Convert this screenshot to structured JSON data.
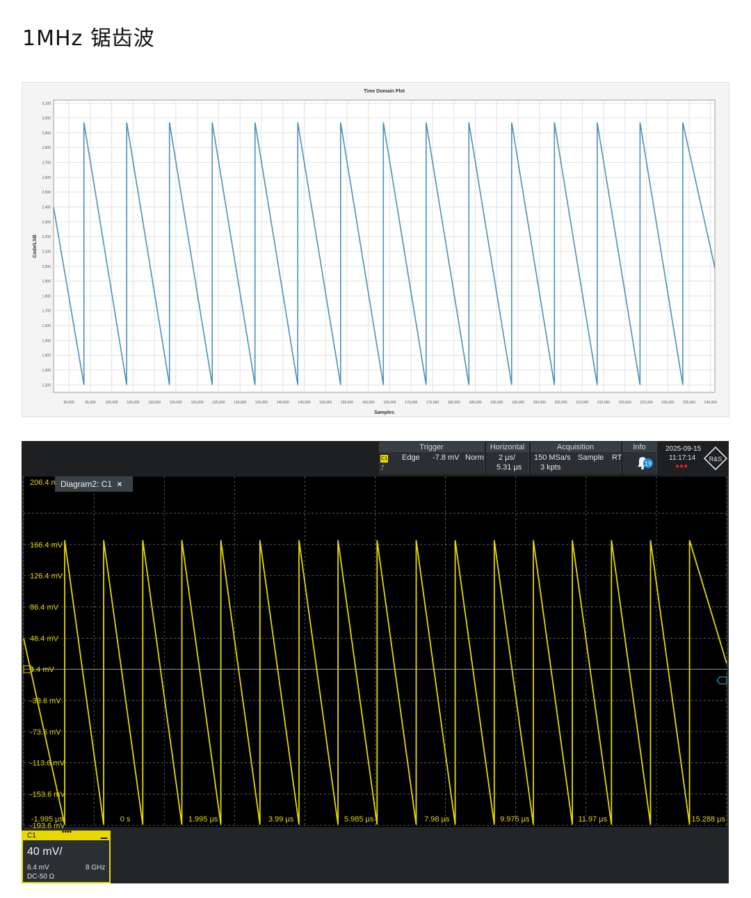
{
  "page_title": "1MHz 锯齿波",
  "chart_data": [
    {
      "type": "line",
      "title": "Time Domain Plot",
      "xlabel": "Samples",
      "ylabel": "Code/LSB",
      "xlim": [
        86400,
        241000
      ],
      "ylim": [
        1150,
        3120
      ],
      "x_ticks": [
        90000,
        95000,
        100000,
        105000,
        110000,
        115000,
        120000,
        125000,
        130000,
        135000,
        140000,
        145000,
        150000,
        155000,
        160000,
        165000,
        170000,
        175000,
        180000,
        185000,
        190000,
        195000,
        200000,
        205000,
        210000,
        215000,
        220000,
        225000,
        230000,
        235000,
        240000
      ],
      "x_tick_labels": [
        "90,000",
        "95,000",
        "100,000",
        "105,000",
        "110,000",
        "115,000",
        "120,000",
        "125,000",
        "130,000",
        "135,000",
        "140,000",
        "145,000",
        "150,000",
        "155,000",
        "160,000",
        "165,000",
        "170,000",
        "175,000",
        "180,000",
        "185,000",
        "190,000",
        "195,000",
        "200,000",
        "205,000",
        "210,000",
        "215,000",
        "220,000",
        "225,000",
        "230,000",
        "235,000",
        "240,000"
      ],
      "y_ticks": [
        1200,
        1300,
        1400,
        1500,
        1600,
        1700,
        1800,
        1900,
        2000,
        2100,
        2200,
        2300,
        2400,
        2500,
        2600,
        2700,
        2800,
        2900,
        3000,
        3100
      ],
      "y_tick_labels": [
        "1,200",
        "1,300",
        "1,400",
        "1,500",
        "1,600",
        "1,700",
        "1,800",
        "1,900",
        "2,000",
        "2,100",
        "2,200",
        "2,300",
        "2,400",
        "2,500",
        "2,600",
        "2,700",
        "2,800",
        "2,900",
        "3,000",
        "3,100"
      ],
      "grid": true,
      "series": [
        {
          "color": "#4a8fb8",
          "x": [
            86400,
            93500,
            93500,
            103500,
            103500,
            113500,
            113500,
            123500,
            123500,
            133500,
            133500,
            143500,
            143500,
            153500,
            153500,
            163500,
            163500,
            173500,
            173500,
            183500,
            183500,
            193500,
            193500,
            203500,
            203500,
            213500,
            213500,
            223500,
            223500,
            233500,
            233500,
            241000
          ],
          "y": [
            2400,
            1200,
            2970,
            1200,
            2970,
            1200,
            2970,
            1200,
            2970,
            1200,
            2970,
            1200,
            2970,
            1200,
            2970,
            1200,
            2970,
            1200,
            2970,
            1200,
            2970,
            1200,
            2970,
            1200,
            2970,
            1200,
            2970,
            1200,
            2970,
            1200,
            2970,
            1990
          ]
        }
      ]
    },
    {
      "type": "line",
      "xlim": [
        -2.6,
        15.4
      ],
      "ylim": [
        -196,
        210
      ],
      "x_ticks": [
        -1.995,
        0,
        1.995,
        3.99,
        5.985,
        7.98,
        9.975,
        11.97,
        15.288
      ],
      "x_tick_labels": [
        "-1.995 µs",
        "0 s",
        "1.995 µs",
        "3.99 µs",
        "5.985 µs",
        "7.98 µs",
        "9.975 µs",
        "11.97 µs",
        "15.288 µs"
      ],
      "y_ticks": [
        206.4,
        166.4,
        126.4,
        86.4,
        46.4,
        6.4,
        -33.6,
        -73.6,
        -113.6,
        -153.6,
        -193.6
      ],
      "y_tick_labels": [
        "206.4 mV",
        "166.4 mV",
        "126.4 mV",
        "86.4 mV",
        "46.4 mV",
        "6.4 mV",
        "-33.6 mV",
        "-73.6 mV",
        "-113.6 mV",
        "-153.6 mV",
        "-193.6 mV"
      ],
      "grid": true,
      "series": [
        {
          "name": "C1",
          "color": "#e8d800",
          "x": [
            -2.6,
            -1.55,
            -1.55,
            -0.55,
            -0.55,
            0.45,
            0.45,
            1.45,
            1.45,
            2.45,
            2.45,
            3.45,
            3.45,
            4.45,
            4.45,
            5.45,
            5.45,
            6.45,
            6.45,
            7.45,
            7.45,
            8.45,
            8.45,
            9.45,
            9.45,
            10.45,
            10.45,
            11.45,
            11.45,
            12.45,
            12.45,
            13.45,
            13.45,
            14.45,
            14.45,
            15.4
          ],
          "y": [
            46,
            -193,
            172,
            -193,
            172,
            -193,
            172,
            -193,
            172,
            -193,
            172,
            -193,
            172,
            -193,
            172,
            -193,
            172,
            -193,
            172,
            -193,
            172,
            -193,
            172,
            -193,
            172,
            -193,
            172,
            -193,
            172,
            -193,
            172,
            -193,
            172,
            -193,
            172,
            14
          ]
        }
      ]
    }
  ],
  "scope": {
    "diagram_tab_label": "Diagram2: C1",
    "diagram_tab_close": "×",
    "header": {
      "trigger_title": "Trigger",
      "trigger_channel": "C1",
      "trigger_type": "Edge",
      "trigger_level": "-7.8 mV",
      "trigger_mode": "Norm",
      "horizontal_title": "Horizontal",
      "horizontal_scale": "2 µs/",
      "horizontal_position": "5.31 µs",
      "acquisition_title": "Acquisition",
      "sample_rate": "150 MSa/s",
      "acq_mode": "Sample",
      "acq_rt": "RT",
      "record_length": "3 kpts",
      "info_title": "Info",
      "info_count": "19",
      "date": "2025-09-15",
      "time": "11:17:14",
      "logo_text": "R&S"
    },
    "channel_panel": {
      "name": "C1",
      "dots": "••••",
      "minimize": "▁",
      "scale": "40 mV/",
      "offset": "6.4 mV",
      "bandwidth": "8 GHz",
      "coupling": "DC-50 Ω"
    },
    "colors": {
      "trace": "#e8d800",
      "grid": "#7a7a7a",
      "trigger_marker": "#27c3e0",
      "background": "#000000"
    }
  }
}
